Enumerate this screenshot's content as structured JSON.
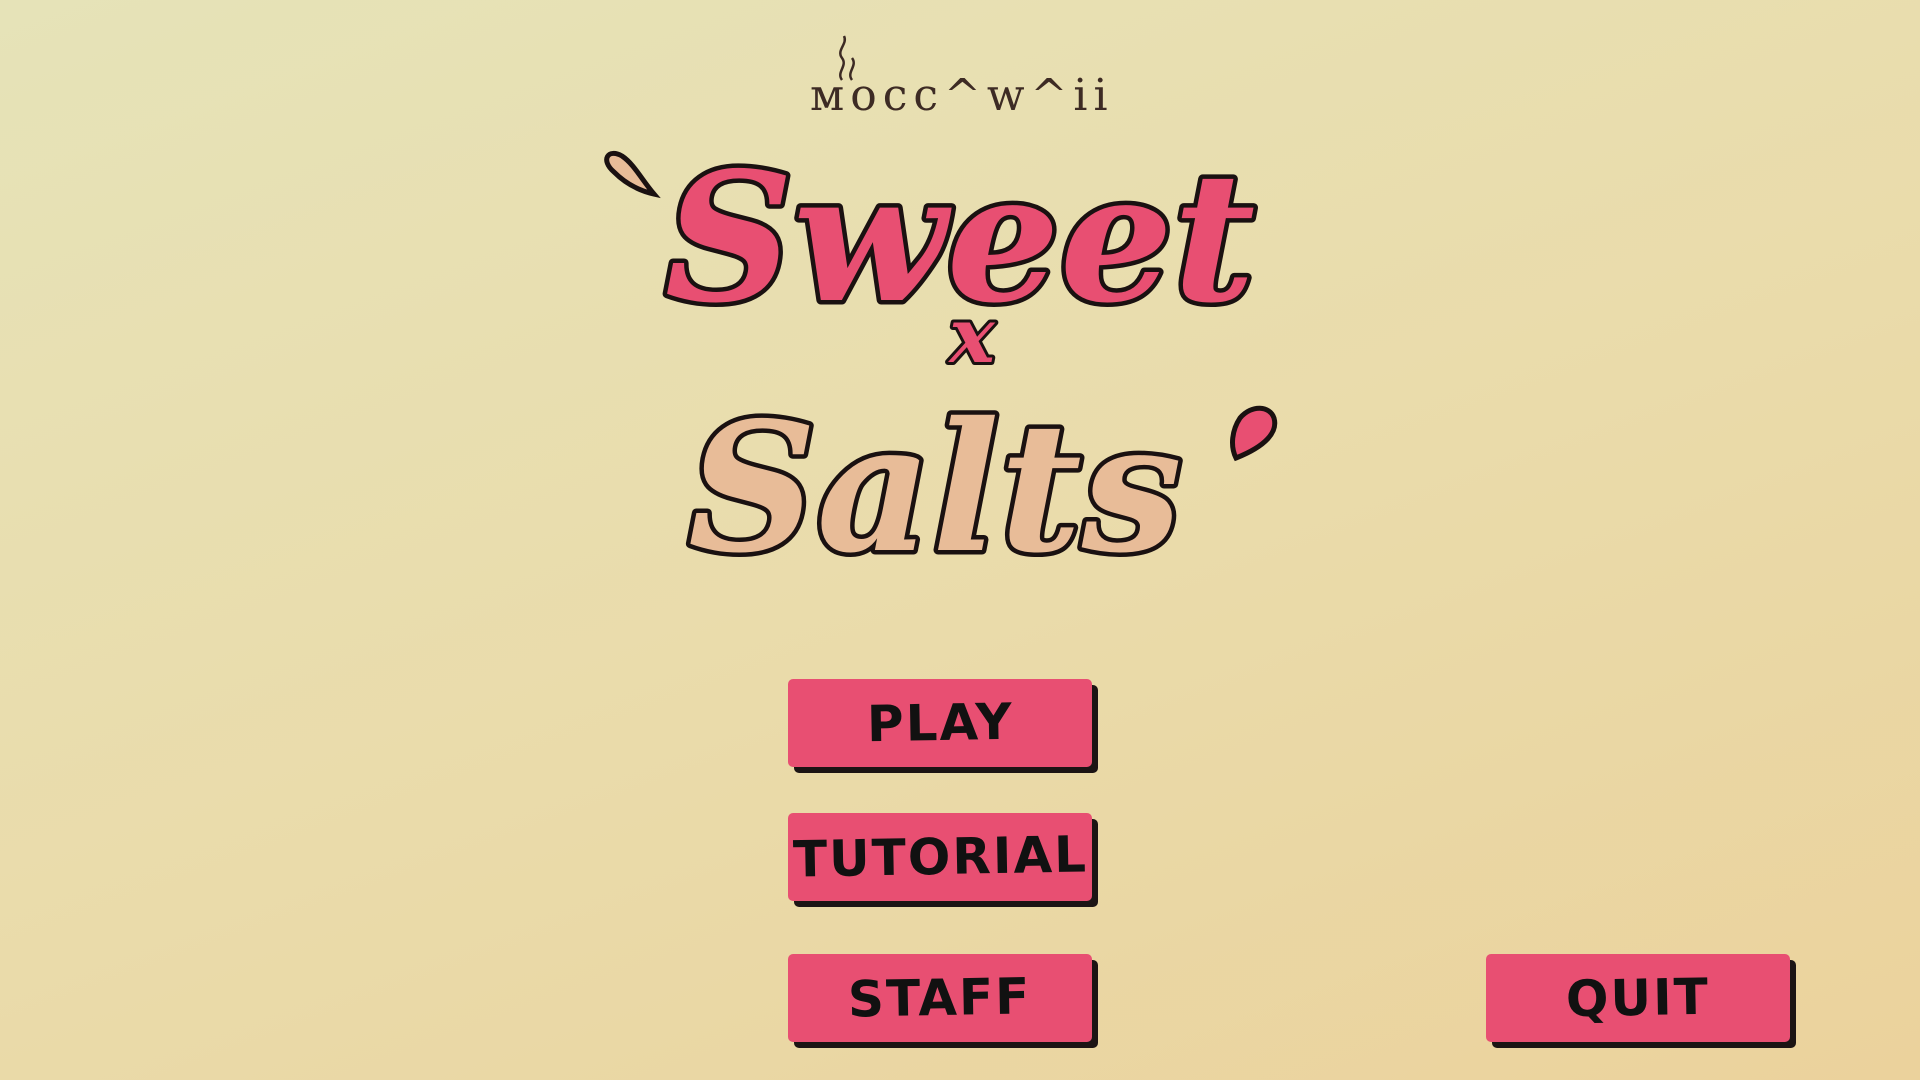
{
  "studio": {
    "name": "Moccawaii",
    "display_text": "ᴍocc^w^ii"
  },
  "title": {
    "line1": "Sweet",
    "connector": "x",
    "line2": "Salts"
  },
  "menu": {
    "play_label": "PLAY",
    "tutorial_label": "TUTORIAL",
    "staff_label": "STAFF",
    "quit_label": "QUIT"
  },
  "colors": {
    "background_light": "#e6e3b8",
    "background_warm": "#ebd29c",
    "button": "#e84f72",
    "button_shadow": "#1c1414",
    "sweet_pink": "#e84f72",
    "salts_peach": "#e8bc98",
    "outline": "#1a1111"
  }
}
